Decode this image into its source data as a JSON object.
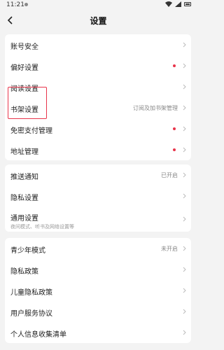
{
  "status": {
    "time": "11:21"
  },
  "header": {
    "title": "设置"
  },
  "group1": [
    {
      "label": "账号安全",
      "value": "",
      "dot": false
    },
    {
      "label": "偏好设置",
      "value": "",
      "dot": true
    },
    {
      "label": "阅读设置",
      "value": "",
      "dot": false
    },
    {
      "label": "书架设置",
      "value": "订阅及加书架管理",
      "dot": false
    },
    {
      "label": "免密支付管理",
      "value": "",
      "dot": true
    },
    {
      "label": "地址管理",
      "value": "",
      "dot": true
    }
  ],
  "group2": [
    {
      "label": "推送通知",
      "value": "已开启"
    },
    {
      "label": "隐私设置",
      "value": ""
    },
    {
      "label": "通用设置",
      "value": "",
      "sub": "夜间模式、听书及网络设置等"
    }
  ],
  "group3": [
    {
      "label": "青少年模式",
      "value": "未开启"
    },
    {
      "label": "隐私政策",
      "value": ""
    },
    {
      "label": "儿童隐私政策",
      "value": ""
    },
    {
      "label": "用户服务协议",
      "value": ""
    },
    {
      "label": "个人信息收集清单",
      "value": ""
    }
  ],
  "icons": {
    "back": "back-arrow-icon",
    "chevron": "chevron-right-icon"
  },
  "colors": {
    "red_dot": "#e8344a",
    "highlight": "#e8344a"
  }
}
